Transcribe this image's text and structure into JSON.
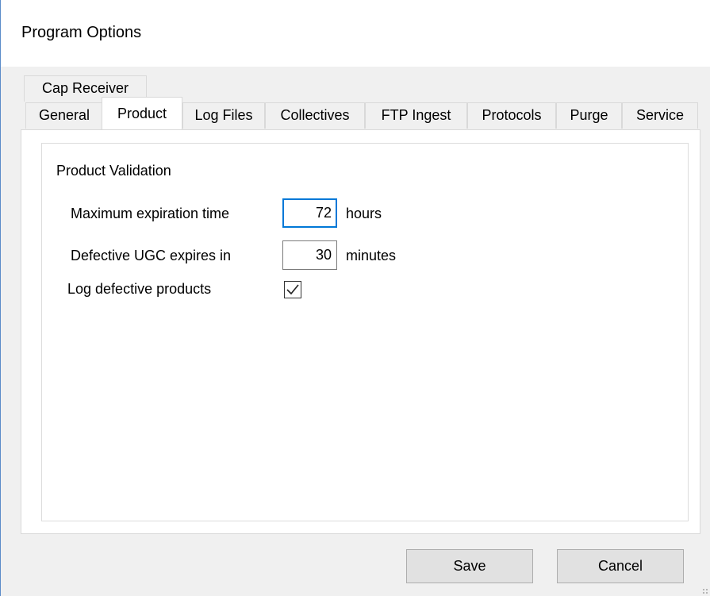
{
  "window": {
    "title": "Program Options"
  },
  "tabs": {
    "row_top": [
      "Cap Receiver"
    ],
    "row_bottom": [
      "General",
      "Product",
      "Log Files",
      "Collectives",
      "FTP Ingest",
      "Protocols",
      "Purge",
      "Service"
    ],
    "selected": "Product"
  },
  "product": {
    "group_title": "Product Validation",
    "max_expiration": {
      "label": "Maximum expiration time",
      "value": "72",
      "unit": "hours"
    },
    "defective_ugc": {
      "label": "Defective UGC expires in",
      "value": "30",
      "unit": "minutes"
    },
    "log_defective": {
      "label": "Log defective products",
      "checked": true
    }
  },
  "buttons": {
    "save": "Save",
    "cancel": "Cancel"
  },
  "colors": {
    "focus_border": "#0078d7",
    "window_border": "#5b8cc9"
  }
}
